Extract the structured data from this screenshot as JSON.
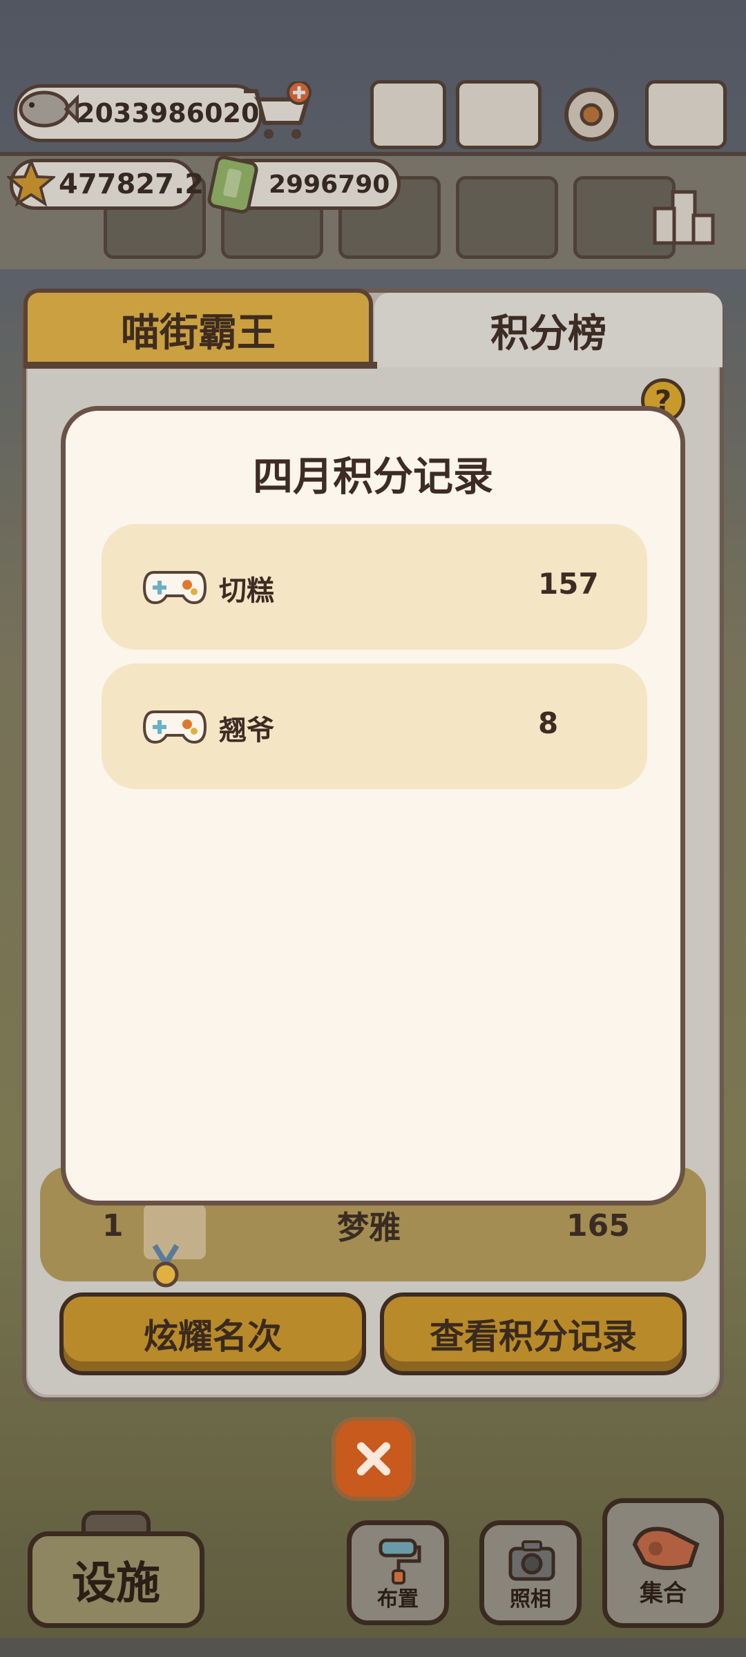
{
  "currency": {
    "fish": "2033986020",
    "stars": "477827.2",
    "tickets": "2996790"
  },
  "tabs": {
    "left": "喵街霸王",
    "right": "积分榜"
  },
  "help_label": "?",
  "my_rank": {
    "rank": "1",
    "name": "梦雅",
    "score": "165"
  },
  "buttons": {
    "show_rank": "炫耀名次",
    "view_records": "查看积分记录"
  },
  "modal": {
    "title": "四月积分记录",
    "records": [
      {
        "name": "切糕",
        "points": "157",
        "icon": "gamepad-icon"
      },
      {
        "name": "翘爷",
        "points": "8",
        "icon": "gamepad-icon"
      }
    ]
  },
  "bottom_bar": {
    "facility": "设施",
    "layout": "布置",
    "photo": "照相",
    "gather": "集合"
  },
  "colors": {
    "gold": "#cba040",
    "modal_bg": "#fbf5ec",
    "record_bg": "#f4e6c4",
    "close_orange": "#c95a1e",
    "dark_brown": "#3d2c24"
  }
}
